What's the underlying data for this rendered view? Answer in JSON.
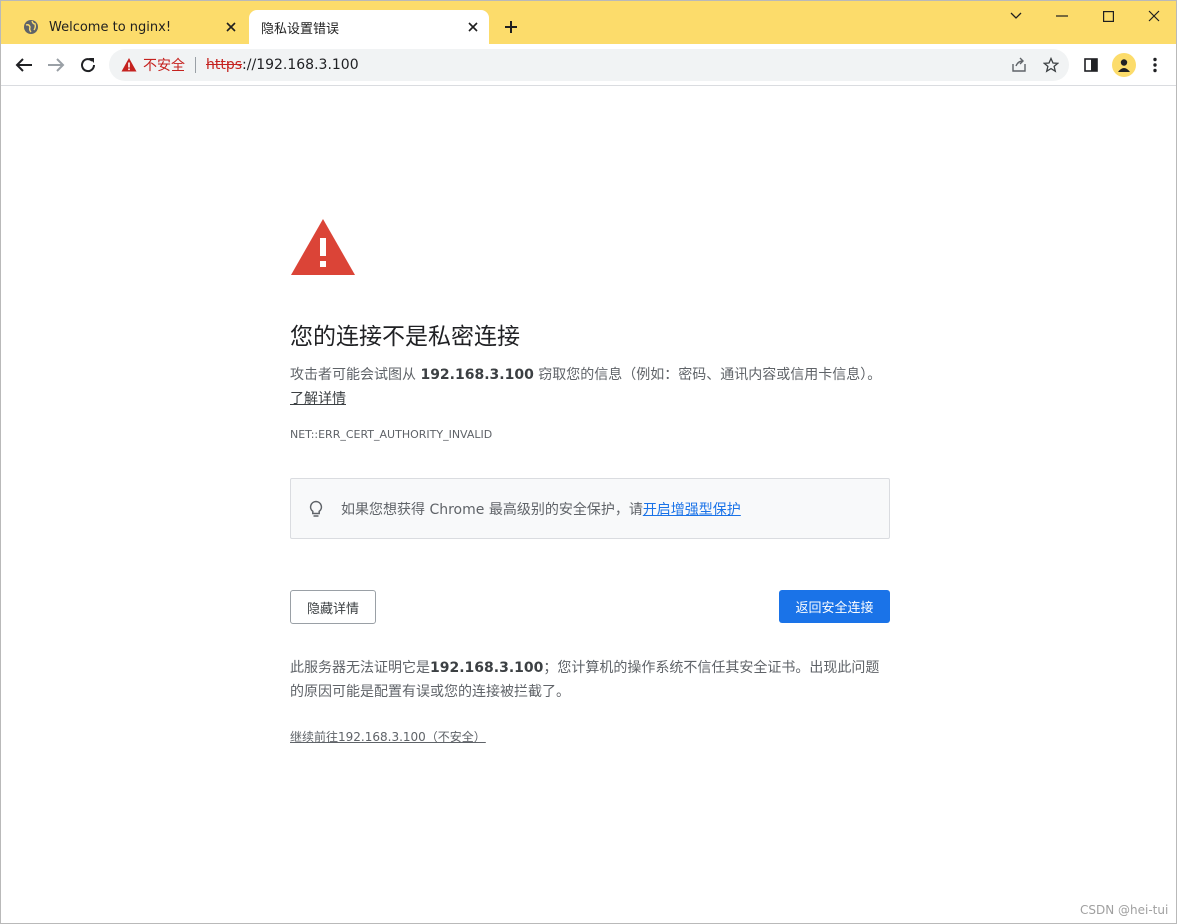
{
  "tabs": [
    {
      "title": "Welcome to nginx!",
      "favicon": "globe-icon",
      "active": false
    },
    {
      "title": "隐私设置错误",
      "favicon": "none",
      "active": true
    }
  ],
  "window_controls": [
    "chevron-down-icon",
    "minimize-icon",
    "maximize-icon",
    "close-icon"
  ],
  "toolbar": {
    "security_label": "不安全",
    "url_scheme": "https",
    "url_rest": "://192.168.3.100"
  },
  "interstitial": {
    "heading": "您的连接不是私密连接",
    "msg_before": "攻击者可能会试图从 ",
    "msg_host": "192.168.3.100",
    "msg_after": " 窃取您的信息（例如：密码、通讯内容或信用卡信息）。",
    "learn_more": "了解详情",
    "error_code": "NET::ERR_CERT_AUTHORITY_INVALID",
    "promo_text": "如果您想获得 Chrome 最高级别的安全保护，请",
    "promo_link": "开启增强型保护",
    "details_button": "隐藏详情",
    "back_button": "返回安全连接",
    "details_before": "此服务器无法证明它是",
    "details_host": "192.168.3.100",
    "details_after": "；您计算机的操作系统不信任其安全证书。出现此问题的原因可能是配置有误或您的连接被拦截了。",
    "proceed_link": "继续前往192.168.3.100（不安全）"
  },
  "colors": {
    "tabstrip": "#fcdc6b",
    "accent_blue": "#1a73e8",
    "warning_red": "#db4437",
    "not_secure_red": "#c5221f"
  },
  "watermark": "CSDN @hei-tui"
}
